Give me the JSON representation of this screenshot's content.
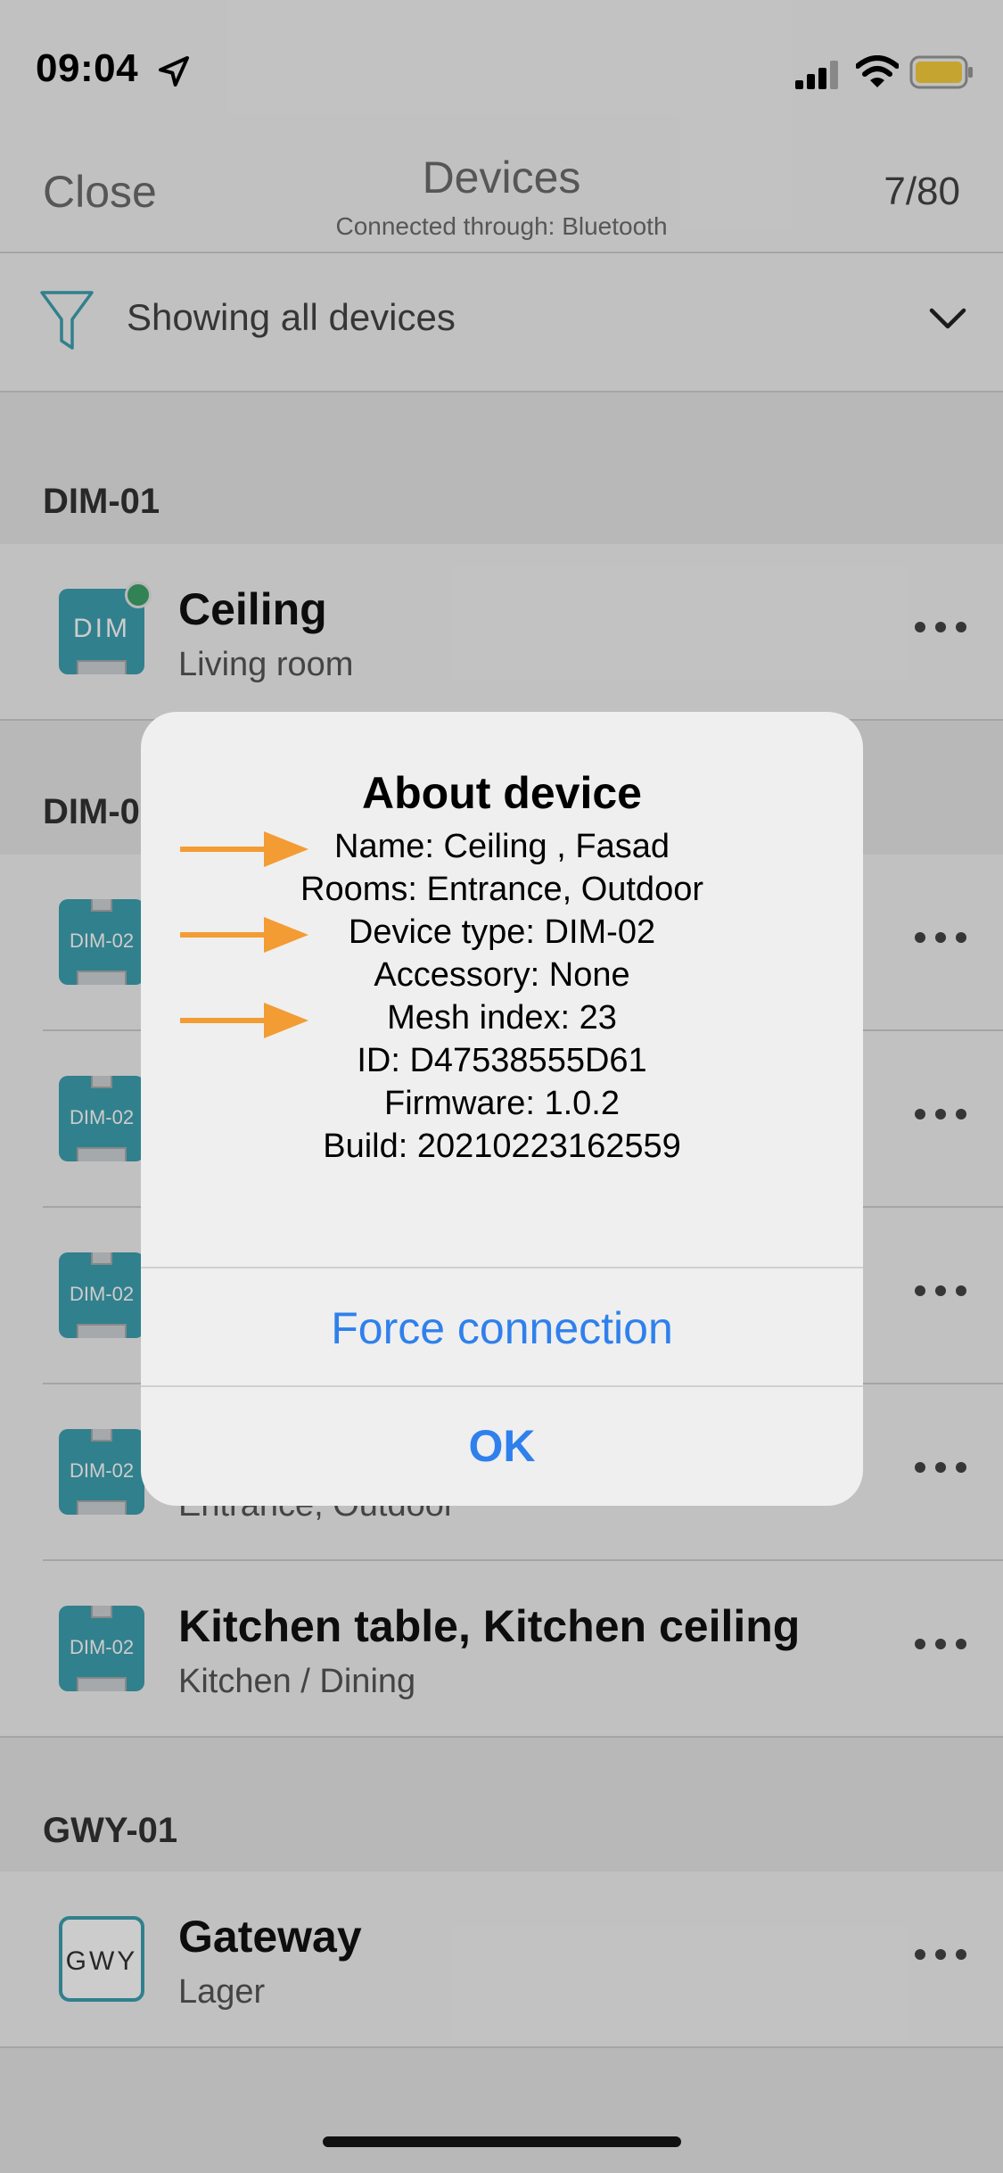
{
  "status_bar": {
    "time": "09:04"
  },
  "header": {
    "close_label": "Close",
    "title": "Devices",
    "subtitle": "Connected through: Bluetooth",
    "count": "7/80"
  },
  "filter": {
    "label": "Showing all devices"
  },
  "sections": [
    {
      "name": "DIM-01"
    },
    {
      "name": "DIM-0"
    },
    {
      "name": "GWY-01"
    }
  ],
  "devices": {
    "ceiling": {
      "icon_label": "DIM",
      "name": "Ceiling",
      "room": "Living room"
    },
    "dim02_1": {
      "icon_label": "DIM-02"
    },
    "dim02_2": {
      "icon_label": "DIM-02"
    },
    "dim02_3": {
      "icon_label": "DIM-02"
    },
    "dim02_4": {
      "icon_label": "DIM-02",
      "room": "Entrance, Outdoor"
    },
    "kitchen": {
      "icon_label": "DIM-02",
      "name": "Kitchen table, Kitchen ceiling",
      "room": "Kitchen / Dining"
    },
    "gateway": {
      "icon_label": "GWY",
      "name": "Gateway",
      "room": "Lager"
    }
  },
  "dialog": {
    "title": "About device",
    "lines": [
      "Name: Ceiling , Fasad",
      "Rooms: Entrance, Outdoor",
      "Device type: DIM-02",
      "Accessory: None",
      "Mesh index: 23",
      "ID: D47538555D61",
      "Firmware: 1.0.2",
      "Build: 20210223162559"
    ],
    "force_label": "Force connection",
    "ok_label": "OK"
  },
  "colors": {
    "accent": "#2f80ed",
    "device_icon": "#3ea0b1",
    "online": "#3ea36a",
    "annotation_arrow": "#f39c33"
  },
  "icons": [
    "location-arrow-icon",
    "signal-icon",
    "wifi-icon",
    "battery-icon",
    "filter-icon",
    "chevron-down-icon",
    "more-icon",
    "arrow-annotation-icon"
  ]
}
